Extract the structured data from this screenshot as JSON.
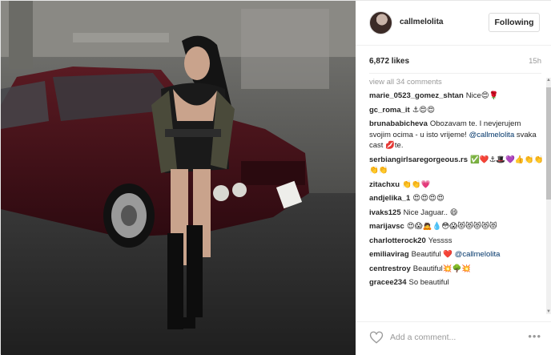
{
  "header": {
    "username": "callmelolita",
    "follow_label": "Following"
  },
  "stats": {
    "likes": "6,872 likes",
    "time": "15h"
  },
  "comments": {
    "view_all": "view all 34 comments",
    "items": [
      {
        "user": "marie_0523_gomez_shtan",
        "text": "Nice😍🌹"
      },
      {
        "user": "gc_roma_it",
        "text": "⚓😍😍"
      },
      {
        "user": "brunababicheva",
        "text": "Obozavam te. I nevjerujem svojim ocima - u isto vrijeme!",
        "mention": "@callmelolita",
        "text2": "svaka cast 💋te."
      },
      {
        "user": "serbiangirlsaregorgeous.rs",
        "text": "✅❤️⚓🎩💜👍👏👏👏👏"
      },
      {
        "user": "zitachxu",
        "text": "👏👏💗"
      },
      {
        "user": "andjelika_1",
        "text": "😍😍😍😍"
      },
      {
        "user": "ivaks125",
        "text": "Nice Jaguar.. 😄"
      },
      {
        "user": "marijavsc",
        "text": "😍😱🙇💧😳😱😻😻😻😻😻"
      },
      {
        "user": "charlotterock20",
        "text": "Yessss"
      },
      {
        "user": "emiliavirag",
        "text": "Beautiful ❤️",
        "mention": "@callmelolita",
        "text2": ""
      },
      {
        "user": "centrestroy",
        "text": "Beautiful💥🌳💥"
      },
      {
        "user": "gracee234",
        "text": "So beautiful"
      }
    ]
  },
  "footer": {
    "comment_placeholder": "Add a comment...",
    "more_label": "•••"
  },
  "icons": {
    "heart": "heart-icon",
    "more": "more-options-icon"
  },
  "colors": {
    "mention": "#003569",
    "muted": "#999999",
    "border": "#efefef"
  }
}
